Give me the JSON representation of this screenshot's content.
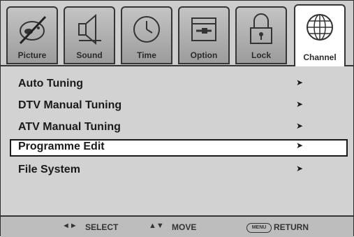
{
  "tabs": [
    {
      "label": "Picture",
      "icon": "picture-icon"
    },
    {
      "label": "Sound",
      "icon": "sound-icon"
    },
    {
      "label": "Time",
      "icon": "clock-icon"
    },
    {
      "label": "Option",
      "icon": "option-icon"
    },
    {
      "label": "Lock",
      "icon": "lock-icon"
    },
    {
      "label": "Channel",
      "icon": "globe-icon",
      "active": true
    }
  ],
  "menu": {
    "items": [
      {
        "label": "Auto Tuning",
        "arrow": "➤"
      },
      {
        "label": "DTV Manual Tuning",
        "arrow": "➤"
      },
      {
        "label": "ATV Manual Tuning",
        "arrow": "➤"
      },
      {
        "label": "Programme Edit",
        "arrow": "➤",
        "selected": true
      },
      {
        "label": "File System",
        "arrow": "➤"
      }
    ]
  },
  "footer": {
    "select_label": "SELECT",
    "move_label": "MOVE",
    "menu_key": "MENU",
    "return_label": "RETURN"
  },
  "colors": {
    "panel": "#d2d2d2",
    "footer": "#bdbdbd",
    "selected": "#ffffff",
    "border": "#353535"
  }
}
